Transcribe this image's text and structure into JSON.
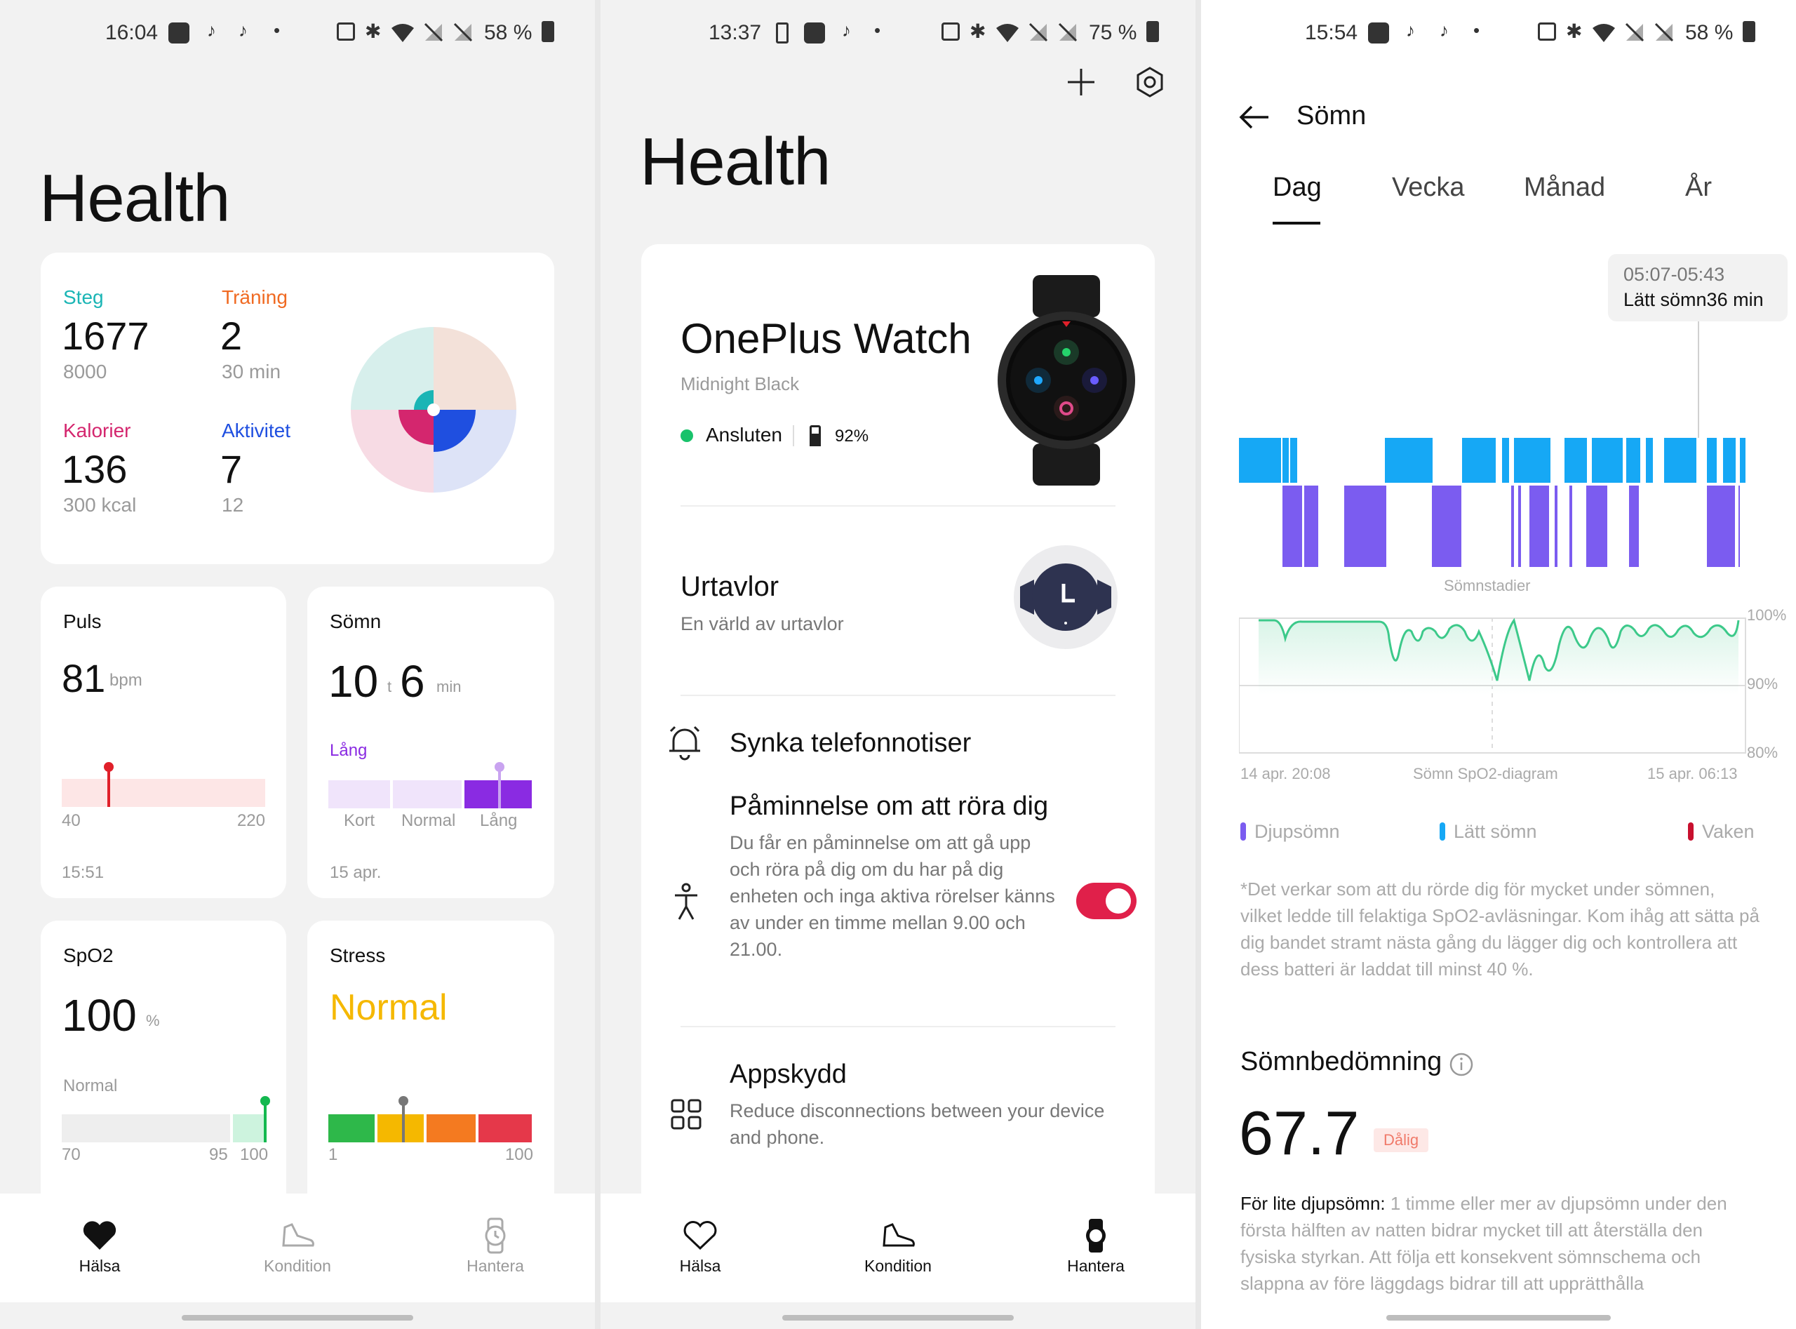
{
  "p1": {
    "status": {
      "time": "16:04",
      "battery": "58 %"
    },
    "title": "Health",
    "summary": {
      "steps": {
        "label": "Steg",
        "value": "1677",
        "goal": "8000",
        "color": "#1ab5b5"
      },
      "training": {
        "label": "Träning",
        "value": "2",
        "goal": "30 min",
        "color": "#f06a22"
      },
      "calories": {
        "label": "Kalorier",
        "value": "136",
        "goal": "300 kcal",
        "color": "#d4266e"
      },
      "activity": {
        "label": "Aktivitet",
        "value": "7",
        "goal": "12",
        "color": "#1f4fe0"
      }
    },
    "pulse": {
      "title": "Puls",
      "value": "81",
      "unit": "bpm",
      "min": "40",
      "max": "220",
      "time": "15:51",
      "level": 0.23
    },
    "sleep": {
      "title": "Sömn",
      "hours": "10",
      "hours_unit": "t",
      "minutes": "6",
      "minutes_unit": "min",
      "category": "Lång",
      "labels": [
        "Kort",
        "Normal",
        "Lång"
      ],
      "date": "15 apr."
    },
    "spo2": {
      "title": "SpO2",
      "value": "100",
      "unit": "%",
      "status": "Normal",
      "axis_min": "70",
      "axis_mid": "95",
      "axis_max": "100"
    },
    "stress": {
      "title": "Stress",
      "value": "Normal",
      "min": "1",
      "max": "100",
      "level": 0.37
    },
    "nav": [
      {
        "label": "Hälsa",
        "icon": "heart-filled-icon"
      },
      {
        "label": "Kondition",
        "icon": "shoe-icon"
      },
      {
        "label": "Hantera",
        "icon": "watch-icon"
      }
    ]
  },
  "p2": {
    "status": {
      "time": "13:37",
      "battery": "75 %"
    },
    "title": "Health",
    "device": {
      "name": "OnePlus Watch",
      "color": "Midnight Black",
      "status": "Ansluten",
      "battery": "92%"
    },
    "watchfaces": {
      "title": "Urtavlor",
      "subtitle": "En värld av urtavlor"
    },
    "sync": {
      "title": "Synka telefonnotiser"
    },
    "reminder": {
      "title": "Påminnelse om att röra dig",
      "desc": "Du får en påminnelse om att gå upp och röra på dig om du har på dig enheten och inga aktiva rörelser känns av under en timme mellan 9.00 och 21.00.",
      "enabled": true
    },
    "appguard": {
      "title": "Appskydd",
      "desc": "Reduce disconnections between your device and phone."
    },
    "nav": [
      {
        "label": "Hälsa",
        "icon": "heart-outline-icon"
      },
      {
        "label": "Kondition",
        "icon": "shoe-icon"
      },
      {
        "label": "Hantera",
        "icon": "watch-filled-icon"
      }
    ]
  },
  "p3": {
    "status": {
      "time": "15:54",
      "battery": "58 %"
    },
    "header": {
      "title": "Sömn"
    },
    "tabs": [
      "Dag",
      "Vecka",
      "Månad",
      "År"
    ],
    "active_tab": "Dag",
    "tooltip": {
      "time": "05:07-05:43",
      "text": "Lätt sömn36 min"
    },
    "stages_label": "Sömnstadier",
    "spo2_chart": {
      "y_labels": [
        "100%",
        "90%",
        "80%"
      ],
      "x_start": "14 apr. 20:08",
      "x_title": "Sömn SpO2-diagram",
      "x_end": "15 apr. 06:13"
    },
    "legend": [
      {
        "label": "Djupsömn",
        "color": "#7b5cf0"
      },
      {
        "label": "Lätt sömn",
        "color": "#16a8f5"
      },
      {
        "label": "Vaken",
        "color": "#c8102e"
      }
    ],
    "note": "*Det verkar som att du rörde dig för mycket under sömnen, vilket ledde till felaktiga SpO2-avläsningar. Kom ihåg att sätta på dig bandet stramt nästa gång du lägger dig och kontrollera att dess batteri är laddat till minst 40 %.",
    "score": {
      "title": "Sömnbedömning",
      "value": "67.7",
      "badge": "Dålig"
    },
    "advice": {
      "lead": "För lite djupsömn:",
      "text": " 1 timme eller mer av djupsömn under den första hälften av natten bidrar mycket till att återställa den fysiska styrkan. Att följa ett konsekvent sömnschema och slappna av före läggdags bidrar till att upprätthålla"
    }
  }
}
